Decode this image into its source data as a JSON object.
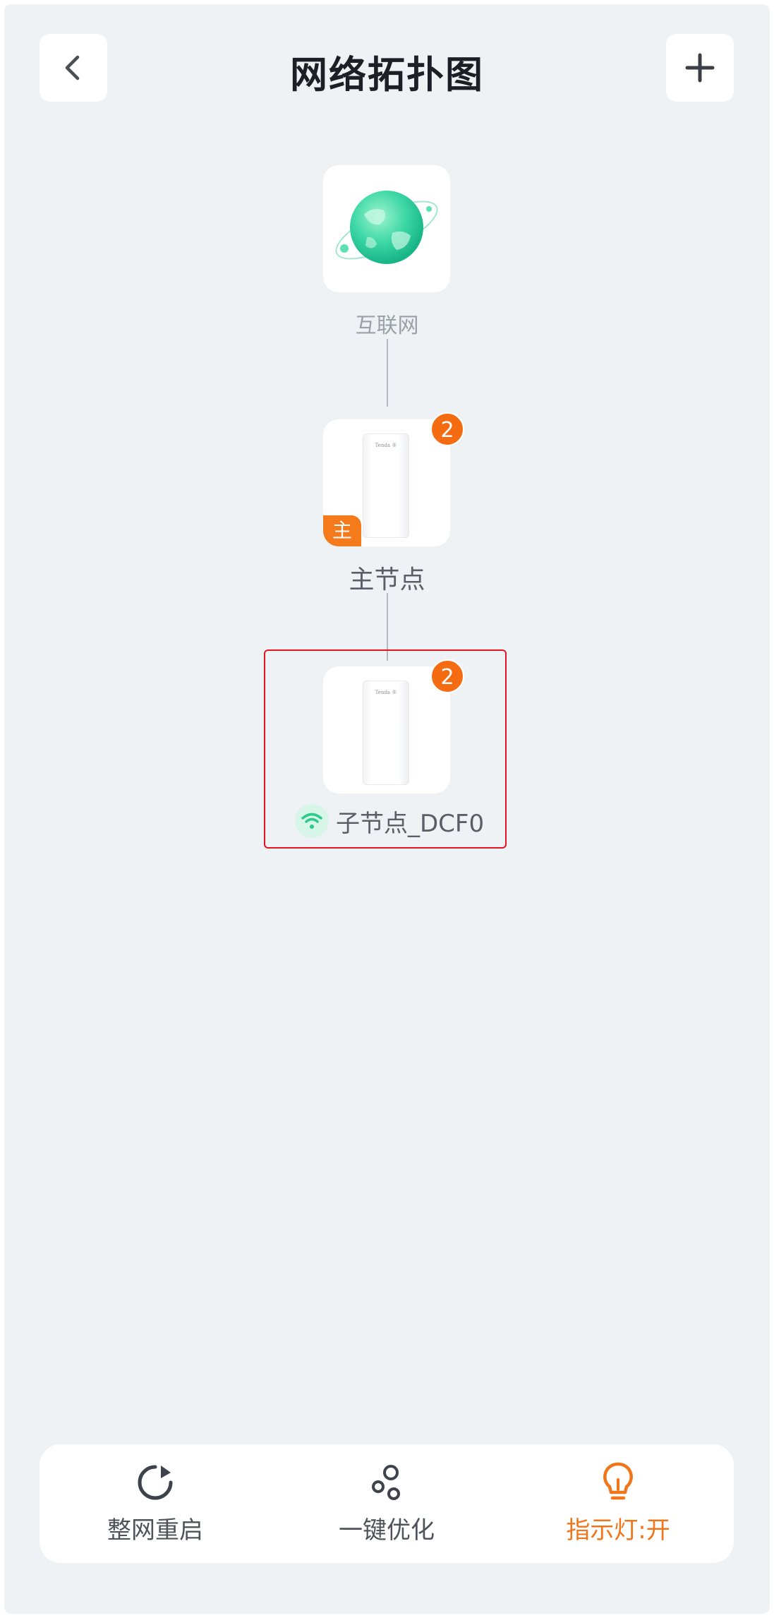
{
  "header": {
    "title": "网络拓扑图",
    "back_icon": "chevron-left-icon",
    "add_icon": "plus-icon"
  },
  "topology": {
    "internet": {
      "label": "互联网",
      "icon": "globe-icon"
    },
    "main_node": {
      "label": "主节点",
      "badge": "2",
      "role_tag": "主"
    },
    "sub_node": {
      "label": "子节点_DCF0",
      "badge": "2",
      "link_icon": "wifi-icon",
      "link_color": "#2ccb8c"
    }
  },
  "toolbar": {
    "items": [
      {
        "label": "整网重启",
        "icon": "restart-icon"
      },
      {
        "label": "一键优化",
        "icon": "optimize-icon"
      },
      {
        "label": "指示灯:开",
        "icon": "lightbulb-icon",
        "active": true
      }
    ]
  },
  "colors": {
    "background": "#eff2f5",
    "accent": "#f56b12",
    "active_text": "#f0761c",
    "selection_border": "#e3141f",
    "globe": "#3ed8a6"
  }
}
